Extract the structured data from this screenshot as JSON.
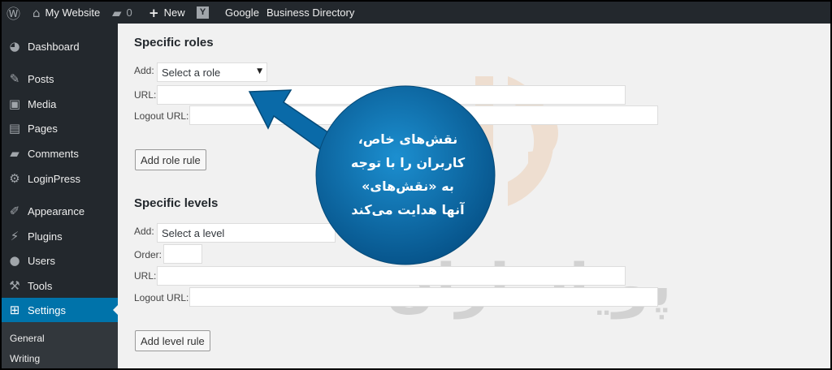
{
  "adminbar": {
    "wp_logo_icon": "wordpress-icon",
    "site_name": "My Website",
    "comments_count": "0",
    "new_label": "New",
    "yoast_icon": "yoast-icon",
    "google_label": "Google",
    "business_directory_label": "Business Directory"
  },
  "sidebar": {
    "items": [
      {
        "label": "Dashboard",
        "icon": "dashboard-icon"
      },
      {
        "label": "Posts",
        "icon": "pin-icon"
      },
      {
        "label": "Media",
        "icon": "media-icon"
      },
      {
        "label": "Pages",
        "icon": "pages-icon"
      },
      {
        "label": "Comments",
        "icon": "comment-icon"
      },
      {
        "label": "LoginPress",
        "icon": "gear-icon"
      },
      {
        "label": "Appearance",
        "icon": "brush-icon"
      },
      {
        "label": "Plugins",
        "icon": "plug-icon"
      },
      {
        "label": "Users",
        "icon": "user-icon"
      },
      {
        "label": "Tools",
        "icon": "wrench-icon"
      },
      {
        "label": "Settings",
        "icon": "settings-icon",
        "active": true
      }
    ],
    "submenu": [
      "General",
      "Writing"
    ]
  },
  "roles": {
    "title": "Specific roles",
    "add_label": "Add:",
    "select_value": "Select a role",
    "url_label": "URL:",
    "logout_label": "Logout URL:",
    "button": "Add role rule"
  },
  "levels": {
    "title": "Specific levels",
    "add_label": "Add:",
    "select_value": "Select a level",
    "order_label": "Order:",
    "url_label": "URL:",
    "logout_label": "Logout URL:",
    "button": "Add level rule"
  },
  "callout": {
    "lines": [
      "نقش‌های خاص،",
      "کاربران را با توجه",
      "به «نقش‌های»",
      "آنها هدایت می‌کند"
    ],
    "color": "#0a6aa8"
  },
  "watermark": {
    "text": "پویاسازان"
  },
  "colors": {
    "adminbar": "#23282d",
    "active": "#0073aa",
    "background": "#f1f1f1"
  }
}
